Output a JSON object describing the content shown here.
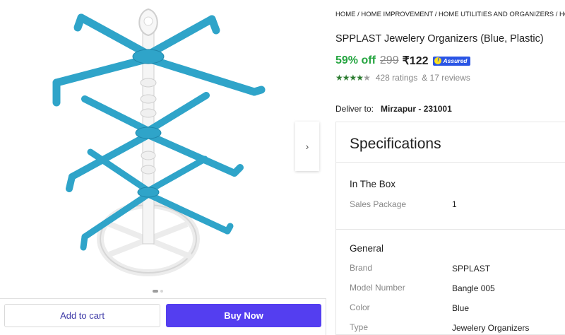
{
  "breadcrumb": "HOME / HOME IMPROVEMENT / HOME UTILITIES AND ORGANIZERS / HOME STORAGE",
  "product": {
    "title": "SPPLAST Jewelery Organizers (Blue, Plastic)",
    "discount": "59% off",
    "mrp": "299",
    "price": "₹122",
    "assured_label": "Assured",
    "rating_value": 4.5,
    "ratings_text": "428 ratings",
    "reviews_text": "& 17 reviews"
  },
  "delivery": {
    "label": "Deliver to:",
    "location": "Mirzapur - 231001"
  },
  "gallery": {
    "next_icon": "›",
    "dots": 2,
    "active_dot": 0,
    "accent_color": "#2fa4c9"
  },
  "actions": {
    "add_to_cart": "Add to cart",
    "buy_now": "Buy Now"
  },
  "specifications": {
    "heading": "Specifications",
    "sections": [
      {
        "title": "In The Box",
        "rows": [
          {
            "key": "Sales Package",
            "value": "1"
          }
        ]
      },
      {
        "title": "General",
        "rows": [
          {
            "key": "Brand",
            "value": "SPPLAST"
          },
          {
            "key": "Model Number",
            "value": "Bangle 005"
          },
          {
            "key": "Color",
            "value": "Blue"
          },
          {
            "key": "Type",
            "value": "Jewelery Organizers"
          }
        ]
      }
    ]
  },
  "colors": {
    "discount_green": "#26a541",
    "buy_button": "#543ef0",
    "assured_blue": "#2a55e5",
    "star_green": "#2e7d32"
  }
}
